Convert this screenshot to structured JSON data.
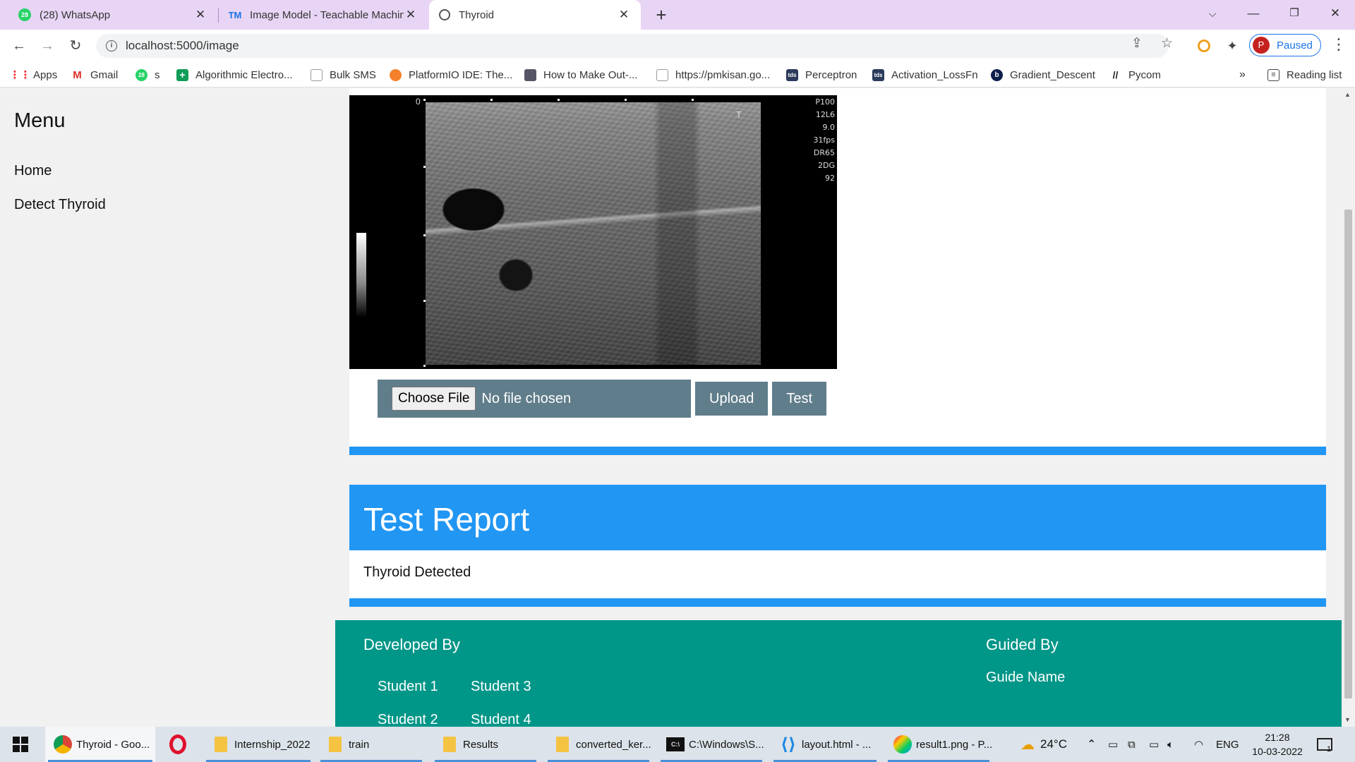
{
  "browser": {
    "tabs": [
      {
        "title": "(28) WhatsApp",
        "badge": "28",
        "active": false
      },
      {
        "title": "Image Model - Teachable Machin",
        "badge": "TM",
        "active": false
      },
      {
        "title": "Thyroid",
        "badge": "",
        "active": true
      }
    ],
    "url": "localhost:5000/image",
    "profile_initial": "P",
    "profile_label": "Paused"
  },
  "bookmarks": {
    "items": [
      "Apps",
      "Gmail",
      "s",
      "Algorithmic Electro...",
      "Bulk SMS",
      "PlatformIO IDE: The...",
      "How to Make Out-...",
      "https://pmkisan.go...",
      "Perceptron",
      "Activation_LossFn",
      "Gradient_Descent",
      "Pycom"
    ],
    "more": "»",
    "reading_list": "Reading list",
    "whatsapp_badge": "28",
    "tds_badge": "tds"
  },
  "sidebar": {
    "title": "Menu",
    "items": [
      "Home",
      "Detect Thyroid"
    ]
  },
  "upload": {
    "image_labels": {
      "zero": "0",
      "params": [
        "P100",
        "12L6",
        "9.0",
        "31fps",
        "DR65",
        "2DG",
        "92"
      ],
      "marker": "T"
    },
    "choose_file": "Choose File",
    "file_status": "No file chosen",
    "upload_button": "Upload",
    "test_button": "Test"
  },
  "report": {
    "title": "Test Report",
    "result": "Thyroid Detected"
  },
  "footer": {
    "developed_by": "Developed By",
    "students": [
      "Student 1",
      "Student 3",
      "Student 2",
      "Student 4"
    ],
    "guided_by": "Guided By",
    "guide_name": "Guide Name"
  },
  "taskbar": {
    "items": [
      "Thyroid - Goo...",
      "Internship_2022",
      "train",
      "Results",
      "converted_ker...",
      "C:\\Windows\\S...",
      "layout.html - ...",
      "result1.png - P..."
    ],
    "temperature": "24°C",
    "language": "ENG",
    "time": "21:28",
    "date": "10-03-2022",
    "notification_count": "1"
  },
  "colors": {
    "primary": "#2196f3",
    "button": "#607d8b",
    "footer": "#009688",
    "tabstrip": "#e8d5f5"
  }
}
